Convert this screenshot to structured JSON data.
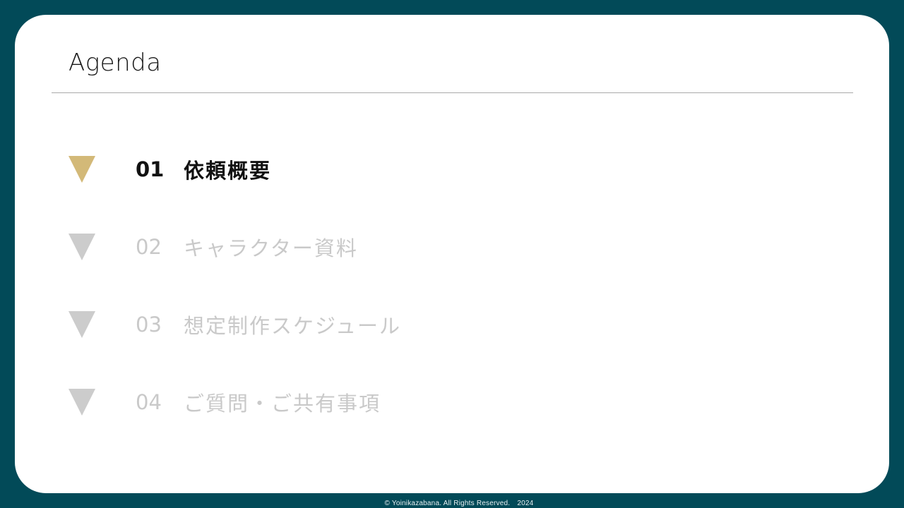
{
  "header": {
    "title": "Agenda"
  },
  "agenda": {
    "items": [
      {
        "number": "01",
        "label": "依頼概要",
        "active": true
      },
      {
        "number": "02",
        "label": "キャラクター資料",
        "active": false
      },
      {
        "number": "03",
        "label": "想定制作スケジュール",
        "active": false
      },
      {
        "number": "04",
        "label": "ご質問・ご共有事項",
        "active": false
      }
    ]
  },
  "footer": {
    "copyright": "© Yoinikazabana. All Rights Reserved.　2024"
  },
  "colors": {
    "background": "#024a58",
    "card": "#ffffff",
    "active_marker": "#d3b978",
    "inactive": "#cccccc",
    "active_text": "#111111"
  }
}
